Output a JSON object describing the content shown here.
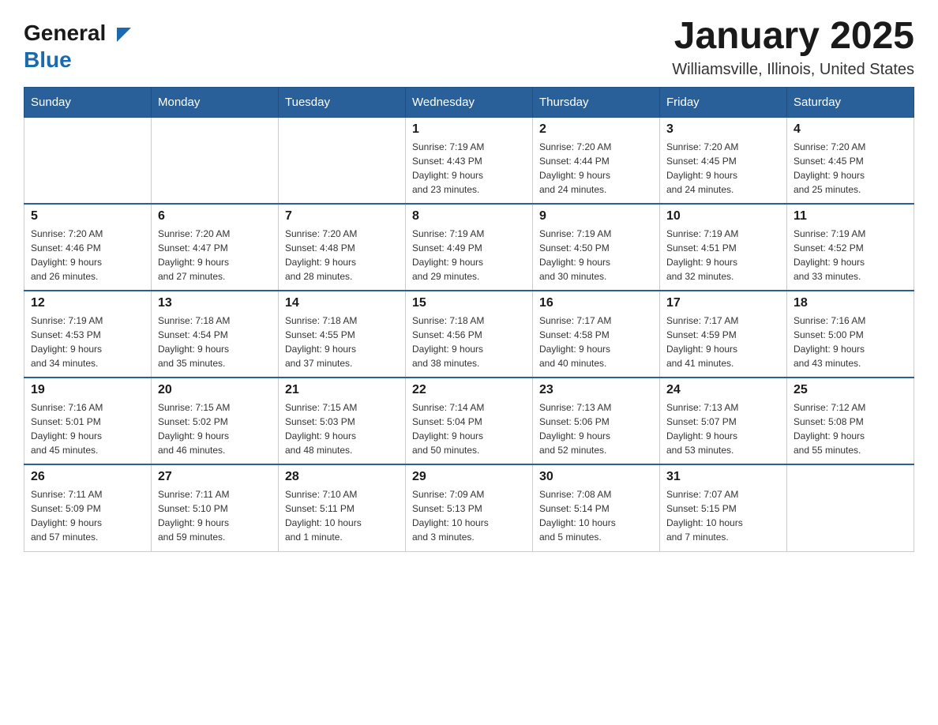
{
  "logo": {
    "general": "General",
    "blue": "Blue"
  },
  "title": {
    "month_year": "January 2025",
    "location": "Williamsville, Illinois, United States"
  },
  "weekdays": [
    "Sunday",
    "Monday",
    "Tuesday",
    "Wednesday",
    "Thursday",
    "Friday",
    "Saturday"
  ],
  "weeks": [
    [
      {
        "day": "",
        "info": ""
      },
      {
        "day": "",
        "info": ""
      },
      {
        "day": "",
        "info": ""
      },
      {
        "day": "1",
        "info": "Sunrise: 7:19 AM\nSunset: 4:43 PM\nDaylight: 9 hours\nand 23 minutes."
      },
      {
        "day": "2",
        "info": "Sunrise: 7:20 AM\nSunset: 4:44 PM\nDaylight: 9 hours\nand 24 minutes."
      },
      {
        "day": "3",
        "info": "Sunrise: 7:20 AM\nSunset: 4:45 PM\nDaylight: 9 hours\nand 24 minutes."
      },
      {
        "day": "4",
        "info": "Sunrise: 7:20 AM\nSunset: 4:45 PM\nDaylight: 9 hours\nand 25 minutes."
      }
    ],
    [
      {
        "day": "5",
        "info": "Sunrise: 7:20 AM\nSunset: 4:46 PM\nDaylight: 9 hours\nand 26 minutes."
      },
      {
        "day": "6",
        "info": "Sunrise: 7:20 AM\nSunset: 4:47 PM\nDaylight: 9 hours\nand 27 minutes."
      },
      {
        "day": "7",
        "info": "Sunrise: 7:20 AM\nSunset: 4:48 PM\nDaylight: 9 hours\nand 28 minutes."
      },
      {
        "day": "8",
        "info": "Sunrise: 7:19 AM\nSunset: 4:49 PM\nDaylight: 9 hours\nand 29 minutes."
      },
      {
        "day": "9",
        "info": "Sunrise: 7:19 AM\nSunset: 4:50 PM\nDaylight: 9 hours\nand 30 minutes."
      },
      {
        "day": "10",
        "info": "Sunrise: 7:19 AM\nSunset: 4:51 PM\nDaylight: 9 hours\nand 32 minutes."
      },
      {
        "day": "11",
        "info": "Sunrise: 7:19 AM\nSunset: 4:52 PM\nDaylight: 9 hours\nand 33 minutes."
      }
    ],
    [
      {
        "day": "12",
        "info": "Sunrise: 7:19 AM\nSunset: 4:53 PM\nDaylight: 9 hours\nand 34 minutes."
      },
      {
        "day": "13",
        "info": "Sunrise: 7:18 AM\nSunset: 4:54 PM\nDaylight: 9 hours\nand 35 minutes."
      },
      {
        "day": "14",
        "info": "Sunrise: 7:18 AM\nSunset: 4:55 PM\nDaylight: 9 hours\nand 37 minutes."
      },
      {
        "day": "15",
        "info": "Sunrise: 7:18 AM\nSunset: 4:56 PM\nDaylight: 9 hours\nand 38 minutes."
      },
      {
        "day": "16",
        "info": "Sunrise: 7:17 AM\nSunset: 4:58 PM\nDaylight: 9 hours\nand 40 minutes."
      },
      {
        "day": "17",
        "info": "Sunrise: 7:17 AM\nSunset: 4:59 PM\nDaylight: 9 hours\nand 41 minutes."
      },
      {
        "day": "18",
        "info": "Sunrise: 7:16 AM\nSunset: 5:00 PM\nDaylight: 9 hours\nand 43 minutes."
      }
    ],
    [
      {
        "day": "19",
        "info": "Sunrise: 7:16 AM\nSunset: 5:01 PM\nDaylight: 9 hours\nand 45 minutes."
      },
      {
        "day": "20",
        "info": "Sunrise: 7:15 AM\nSunset: 5:02 PM\nDaylight: 9 hours\nand 46 minutes."
      },
      {
        "day": "21",
        "info": "Sunrise: 7:15 AM\nSunset: 5:03 PM\nDaylight: 9 hours\nand 48 minutes."
      },
      {
        "day": "22",
        "info": "Sunrise: 7:14 AM\nSunset: 5:04 PM\nDaylight: 9 hours\nand 50 minutes."
      },
      {
        "day": "23",
        "info": "Sunrise: 7:13 AM\nSunset: 5:06 PM\nDaylight: 9 hours\nand 52 minutes."
      },
      {
        "day": "24",
        "info": "Sunrise: 7:13 AM\nSunset: 5:07 PM\nDaylight: 9 hours\nand 53 minutes."
      },
      {
        "day": "25",
        "info": "Sunrise: 7:12 AM\nSunset: 5:08 PM\nDaylight: 9 hours\nand 55 minutes."
      }
    ],
    [
      {
        "day": "26",
        "info": "Sunrise: 7:11 AM\nSunset: 5:09 PM\nDaylight: 9 hours\nand 57 minutes."
      },
      {
        "day": "27",
        "info": "Sunrise: 7:11 AM\nSunset: 5:10 PM\nDaylight: 9 hours\nand 59 minutes."
      },
      {
        "day": "28",
        "info": "Sunrise: 7:10 AM\nSunset: 5:11 PM\nDaylight: 10 hours\nand 1 minute."
      },
      {
        "day": "29",
        "info": "Sunrise: 7:09 AM\nSunset: 5:13 PM\nDaylight: 10 hours\nand 3 minutes."
      },
      {
        "day": "30",
        "info": "Sunrise: 7:08 AM\nSunset: 5:14 PM\nDaylight: 10 hours\nand 5 minutes."
      },
      {
        "day": "31",
        "info": "Sunrise: 7:07 AM\nSunset: 5:15 PM\nDaylight: 10 hours\nand 7 minutes."
      },
      {
        "day": "",
        "info": ""
      }
    ]
  ]
}
